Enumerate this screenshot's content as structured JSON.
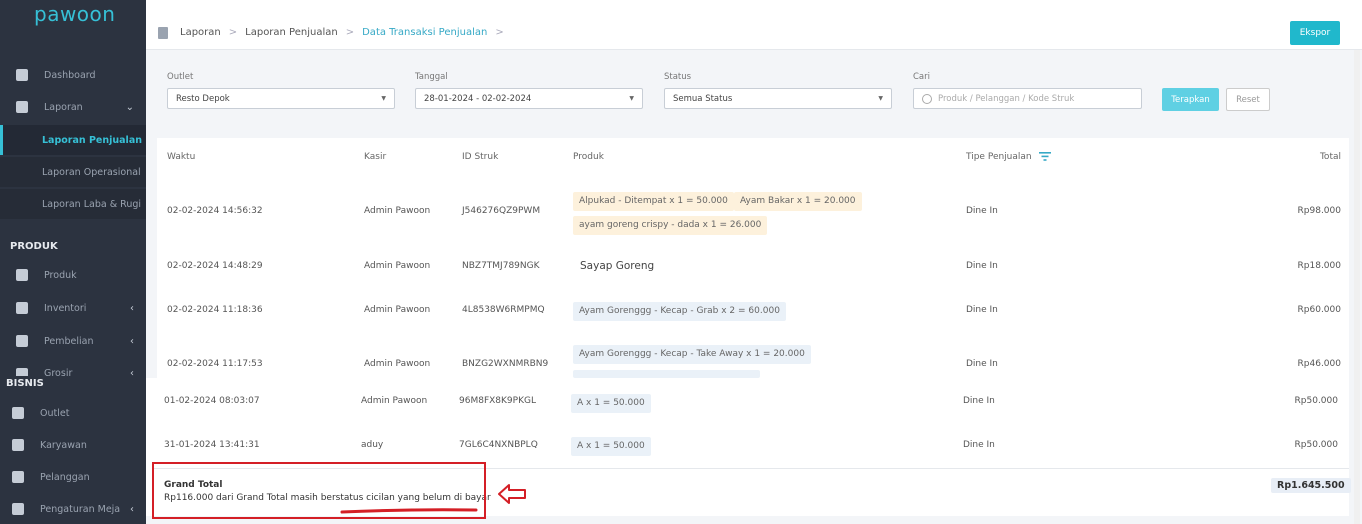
{
  "sidebar": {
    "logo": "pawoon",
    "items": [
      {
        "label": "Dashboard",
        "icon": "chart-icon"
      },
      {
        "label": "Laporan",
        "icon": "clipboard-icon"
      }
    ],
    "laporan_sub": [
      {
        "label": "Laporan Penjualan",
        "active": true
      },
      {
        "label": "Laporan Operasional",
        "active": false
      },
      {
        "label": "Laporan Laba & Rugi",
        "active": false
      }
    ],
    "produk_title": "PRODUK",
    "produk_items": [
      {
        "label": "Produk",
        "icon": "bag-icon"
      },
      {
        "label": "Inventori",
        "icon": "box-icon"
      },
      {
        "label": "Pembelian",
        "icon": "receipt-icon"
      },
      {
        "label": "Grosir",
        "icon": "tag-icon"
      }
    ],
    "bisnis_title": "BISNIS",
    "bisnis_items": [
      {
        "label": "Outlet",
        "icon": "store-icon"
      },
      {
        "label": "Karyawan",
        "icon": "id-card-icon"
      },
      {
        "label": "Pelanggan",
        "icon": "users-icon"
      },
      {
        "label": "Pengaturan Meja",
        "icon": "table-icon"
      }
    ]
  },
  "breadcrumb": {
    "items": [
      "Laporan",
      "Laporan Penjualan",
      "Data Transaksi Penjualan"
    ],
    "separator": ">"
  },
  "header": {
    "export_label": "Ekspor"
  },
  "filters": {
    "outlet_label": "Outlet",
    "outlet_value": "Resto Depok",
    "tanggal_label": "Tanggal",
    "tanggal_value": "28-01-2024 - 02-02-2024",
    "status_label": "Status",
    "status_value": "Semua Status",
    "cari_label": "Cari",
    "cari_placeholder": "Produk / Pelanggan / Kode Struk",
    "apply_label": "Terapkan",
    "reset_label": "Reset"
  },
  "table": {
    "headers": {
      "waktu": "Waktu",
      "kasir": "Kasir",
      "id_struk": "ID Struk",
      "produk": "Produk",
      "tipe": "Tipe Penjualan",
      "total": "Total"
    },
    "rows": [
      {
        "waktu": "02-02-2024 14:56:32",
        "kasir": "Admin Pawoon",
        "id": "J546276QZ9PWM",
        "produk": [
          "Alpukad - Ditempat x 1 = 50.000",
          "Ayam Bakar x 1 = 20.000",
          "ayam goreng crispy - dada x 1 = 26.000"
        ],
        "tipe": "Dine In",
        "total": "Rp98.000"
      },
      {
        "waktu": "02-02-2024 14:48:29",
        "kasir": "Admin Pawoon",
        "id": "NBZ7TMJ789NGK",
        "produk": [
          "Sayap Goreng"
        ],
        "tipe": "Dine In",
        "total": "Rp18.000"
      },
      {
        "waktu": "02-02-2024 11:18:36",
        "kasir": "Admin Pawoon",
        "id": "4L8538W6RMPMQ",
        "produk": [
          "Ayam Gorenggg - Kecap - Grab x 2 = 60.000"
        ],
        "tipe": "Dine In",
        "total": "Rp60.000"
      },
      {
        "waktu": "02-02-2024 11:17:53",
        "kasir": "Admin Pawoon",
        "id": "BNZG2WXNMRBN9",
        "produk": [
          "Ayam Gorenggg - Kecap - Take Away x 1 = 20.000"
        ],
        "tipe": "Dine In",
        "total": "Rp46.000"
      },
      {
        "waktu": "01-02-2024 08:03:07",
        "kasir": "Admin Pawoon",
        "id": "96M8FX8K9PKGL",
        "produk": [
          "A x 1 = 50.000"
        ],
        "tipe": "Dine In",
        "total": "Rp50.000"
      },
      {
        "waktu": "31-01-2024 13:41:31",
        "kasir": "aduy",
        "id": "7GL6C4NXNBPLQ",
        "produk": [
          "A x 1 = 50.000"
        ],
        "tipe": "Dine In",
        "total": "Rp50.000"
      }
    ]
  },
  "grand_total": {
    "title": "Grand Total",
    "note": "Rp116.000 dari Grand Total masih berstatus cicilan yang belum di bayar",
    "value": "Rp1.645.500"
  },
  "colors": {
    "accent": "#20b8cc",
    "sidebar": "#2c3340",
    "annotation": "#d41f26"
  }
}
